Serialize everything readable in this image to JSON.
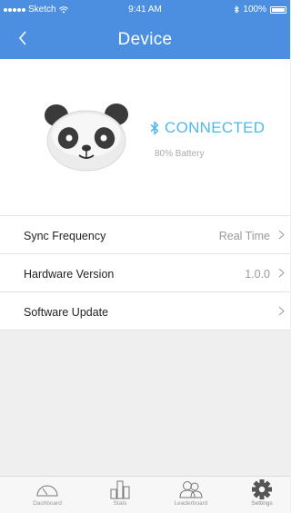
{
  "status_bar": {
    "carrier": "Sketch",
    "time": "9:41 AM",
    "battery": "100%"
  },
  "nav": {
    "title": "Device",
    "back_icon": "chevron-left-icon"
  },
  "device": {
    "status": "CONNECTED",
    "battery_text": "80% Battery",
    "status_color": "#4fb9e6",
    "icon": "bluetooth-icon"
  },
  "settings_rows": [
    {
      "label": "Sync Frequency",
      "value": "Real Time"
    },
    {
      "label": "Hardware Version",
      "value": "1.0.0"
    },
    {
      "label": "Software Update",
      "value": ""
    }
  ],
  "tabs": [
    {
      "label": "Dashboard",
      "icon": "gauge-icon"
    },
    {
      "label": "Stats",
      "icon": "bar-chart-icon"
    },
    {
      "label": "Leaderboard",
      "icon": "users-icon"
    },
    {
      "label": "Settings",
      "icon": "gear-icon",
      "active": true
    }
  ],
  "colors": {
    "header": "#4c8fe0",
    "accent": "#4fb9e6"
  }
}
